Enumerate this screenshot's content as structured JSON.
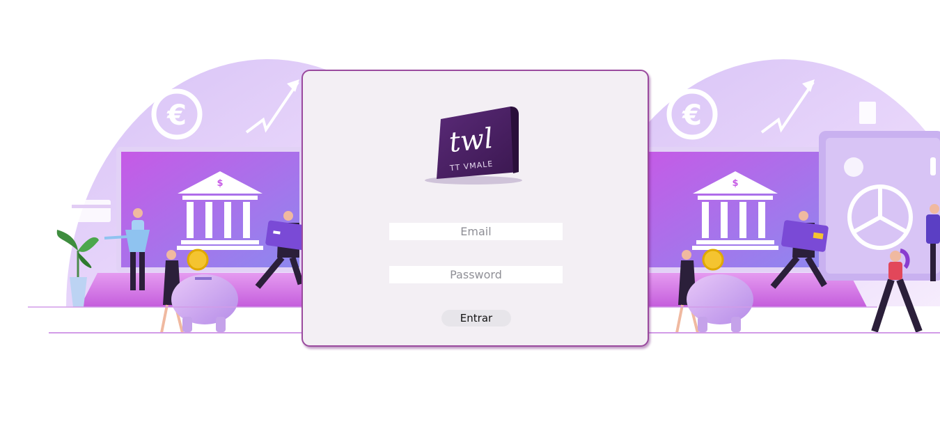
{
  "logo": {
    "letters": "twl",
    "brand": "TT VMALE"
  },
  "login": {
    "email_placeholder": "Email",
    "password_placeholder": "Password",
    "submit_label": "Entrar"
  },
  "illustration": {
    "currency_symbol": "€",
    "dollar_symbol": "$"
  },
  "colors": {
    "card_border": "#9a4a9e",
    "card_background": "#f3eff4",
    "accent_purple": "#b24ad8"
  }
}
